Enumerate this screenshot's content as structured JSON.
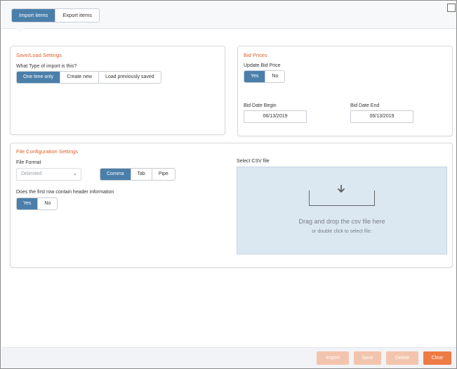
{
  "tabs": [
    {
      "label": "Import items",
      "active": true
    },
    {
      "label": "Export items",
      "active": false
    }
  ],
  "save_load": {
    "title": "Save/Load Settings",
    "question": "What Type of import is this?",
    "options": [
      "One time only",
      "Create new",
      "Load previously saved"
    ],
    "selected": "One time only"
  },
  "bid_prices": {
    "title": "Bid Prices",
    "update_label": "Update Bid Price",
    "update_options": [
      "Yes",
      "No"
    ],
    "update_selected": "Yes",
    "begin_label": "Bid Date Begin",
    "begin_value": "06/13/2019",
    "end_label": "Bid Date End",
    "end_value": "06/13/2019"
  },
  "file_config": {
    "title": "File Configuration Settings",
    "format_label": "File Format",
    "format_value": "Delimited",
    "delimiters": [
      "Comma",
      "Tab",
      "Pipe"
    ],
    "delimiter_selected": "Comma",
    "header_question": "Does the first row contain header information",
    "header_options": [
      "Yes",
      "No"
    ],
    "header_selected": "Yes",
    "csv_label": "Select CSV file",
    "drop_main": "Drag and drop the csv file here",
    "drop_sub": "or double click to select file."
  },
  "footer": {
    "import": "Import",
    "save": "Save",
    "delete": "Delete",
    "clear": "Clear"
  },
  "colors": {
    "accent_blue": "#4a7faa",
    "section_title": "#e35f2a",
    "primary_button": "#ee7a45",
    "disabled_button": "#f3c4ad",
    "drop_zone": "#dbe8f2"
  }
}
